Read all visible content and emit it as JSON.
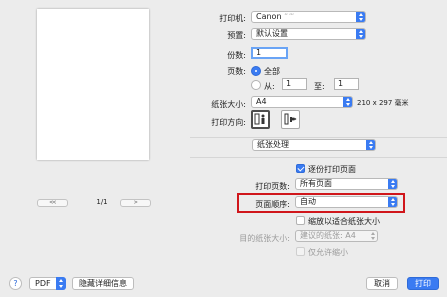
{
  "preview": {
    "page_label": "1/1",
    "first_glyph": "<<",
    "prev_glyph": "<",
    "next_glyph": ">",
    "last_glyph": ">>"
  },
  "printer": {
    "label": "打印机:",
    "value": "Canon",
    "value_blurred": "ʻʻ ʻʻʻ"
  },
  "preset": {
    "label": "预置:",
    "value": "默认设置"
  },
  "copies": {
    "label": "份数:",
    "value": "1"
  },
  "pages": {
    "label": "页数:",
    "all_label": "全部",
    "from_label": "从:",
    "from_value": "1",
    "to_label": "至:",
    "to_value": "1"
  },
  "paper_size": {
    "label": "纸张大小:",
    "value": "A4",
    "dimensions": "210 x 297 毫米"
  },
  "orientation": {
    "label": "打印方向:"
  },
  "section": {
    "value": "纸张处理"
  },
  "collate": {
    "label": "逐份打印页面"
  },
  "pages_to_print": {
    "label": "打印页数:",
    "value": "所有页面"
  },
  "page_order": {
    "label": "页面顺序:",
    "value": "自动"
  },
  "scale_to_fit": {
    "label": "缩放以适合纸张大小"
  },
  "dest_paper": {
    "label": "目的纸张大小:",
    "value": "建议的纸张: A4"
  },
  "scale_down_only": {
    "label": "仅允许缩小"
  },
  "footer": {
    "help": "?",
    "pdf_label": "PDF",
    "hide_details": "隐藏详细信息",
    "cancel": "取消",
    "print": "打印"
  },
  "colors": {
    "accent": "#3a7bf2",
    "highlight": "#d0161b"
  }
}
